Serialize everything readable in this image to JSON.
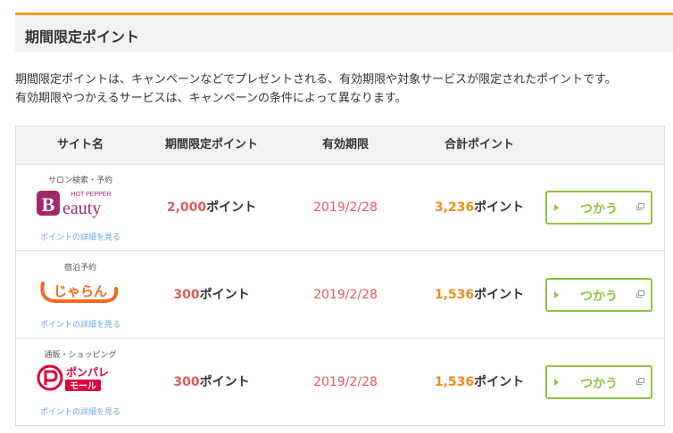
{
  "section": {
    "title": "期間限定ポイント"
  },
  "description": {
    "line1": "期間限定ポイントは、キャンペーンなどでプレゼントされる、有効期限や対象サービスが限定されたポイントです。",
    "line2": "有効期限やつかえるサービスは、キャンペーンの条件によって異なります。"
  },
  "table": {
    "headers": [
      "サイト名",
      "期間限定ポイント",
      "有効期限",
      "合計ポイント"
    ],
    "rows": [
      {
        "category": "サロン検索・予約",
        "logo": {
          "name": "hotpepper-beauty-logo",
          "small": "HOT PEPPER",
          "big": "Beauty",
          "color": "#a3286a"
        },
        "detail_link": "ポイントの詳細を見る",
        "points": "2,000",
        "points_unit": "ポイント",
        "expiry": "2019/2/28",
        "total": "3,236",
        "total_unit": "ポイント",
        "button": "つかう"
      },
      {
        "category": "宿泊予約",
        "logo": {
          "name": "jalan-logo",
          "text": "じゃらん",
          "color": "#f26b1d"
        },
        "detail_link": "ポイントの詳細を見る",
        "points": "300",
        "points_unit": "ポイント",
        "expiry": "2019/2/28",
        "total": "1,536",
        "total_unit": "ポイント",
        "button": "つかう"
      },
      {
        "category": "通販・ショッピング",
        "logo": {
          "name": "ponpare-mall-logo",
          "top": "ポンパレ",
          "bottom": "モール",
          "color": "#e0003a"
        },
        "detail_link": "ポイントの詳細を見る",
        "points": "300",
        "points_unit": "ポイント",
        "expiry": "2019/2/28",
        "total": "1,536",
        "total_unit": "ポイント",
        "button": "つかう"
      }
    ]
  },
  "colors": {
    "accent_orange": "#f59b1c",
    "points_red": "#e05a5a",
    "total_orange": "#f08c1e",
    "button_green": "#8ec241",
    "link_blue": "#6fa6d6"
  }
}
